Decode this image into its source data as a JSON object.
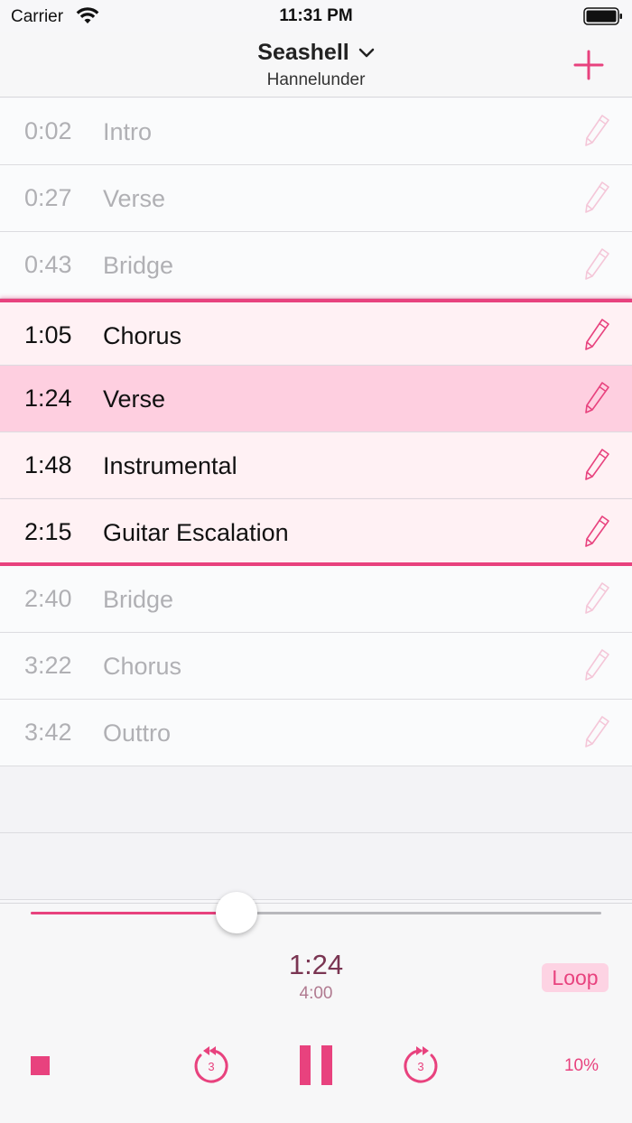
{
  "status_bar": {
    "carrier": "Carrier",
    "time": "11:31 PM"
  },
  "nav": {
    "title": "Seashell",
    "subtitle": "Hannelunder",
    "accent_color": "#e8427e"
  },
  "sections": [
    {
      "time": "0:02",
      "name": "Intro",
      "state": "inactive"
    },
    {
      "time": "0:27",
      "name": "Verse",
      "state": "inactive"
    },
    {
      "time": "0:43",
      "name": "Bridge",
      "state": "inactive"
    },
    {
      "time": "1:05",
      "name": "Chorus",
      "state": "loop-start"
    },
    {
      "time": "1:24",
      "name": "Verse",
      "state": "current"
    },
    {
      "time": "1:48",
      "name": "Instrumental",
      "state": "loop"
    },
    {
      "time": "2:15",
      "name": "Guitar Escalation",
      "state": "loop-end"
    },
    {
      "time": "2:40",
      "name": "Bridge",
      "state": "inactive"
    },
    {
      "time": "3:22",
      "name": "Chorus",
      "state": "inactive"
    },
    {
      "time": "3:42",
      "name": "Outtro",
      "state": "inactive"
    }
  ],
  "player": {
    "current_time": "1:24",
    "total_time": "4:00",
    "progress": 0.36,
    "loop_label": "Loop",
    "skip_seconds": "3",
    "speed_label": "10%"
  }
}
